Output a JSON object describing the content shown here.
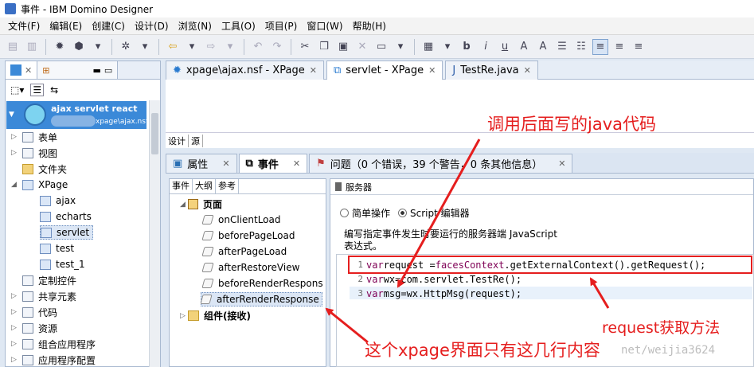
{
  "window": {
    "title": "事件 - IBM Domino Designer"
  },
  "menu": [
    "文件(F)",
    "编辑(E)",
    "创建(C)",
    "设计(D)",
    "浏览(N)",
    "工具(O)",
    "项目(P)",
    "窗口(W)",
    "帮助(H)"
  ],
  "nav": {
    "database": {
      "name": "ajax servlet react",
      "path": "xpage\\ajax.nsf"
    },
    "items": [
      {
        "label": "表单",
        "depth": 0,
        "expander": "closed",
        "icon": "form-icon"
      },
      {
        "label": "视图",
        "depth": 0,
        "expander": "closed",
        "icon": "view-icon"
      },
      {
        "label": "文件夹",
        "depth": 0,
        "expander": "none",
        "icon": "folder-icon"
      },
      {
        "label": "XPage",
        "depth": 0,
        "expander": "open",
        "icon": "xpage-icon"
      },
      {
        "label": "ajax",
        "depth": 1,
        "expander": "none",
        "icon": "xpage-icon"
      },
      {
        "label": "echarts",
        "depth": 1,
        "expander": "none",
        "icon": "xpage-icon"
      },
      {
        "label": "servlet",
        "depth": 1,
        "expander": "none",
        "icon": "xpage-icon",
        "selected": true
      },
      {
        "label": "test",
        "depth": 1,
        "expander": "none",
        "icon": "xpage-icon"
      },
      {
        "label": "test_1",
        "depth": 1,
        "expander": "none",
        "icon": "xpage-icon"
      },
      {
        "label": "定制控件",
        "depth": 0,
        "expander": "none",
        "icon": "custom-control-icon"
      },
      {
        "label": "共享元素",
        "depth": 0,
        "expander": "closed",
        "icon": "shared-elements-icon"
      },
      {
        "label": "代码",
        "depth": 0,
        "expander": "closed",
        "icon": "code-icon"
      },
      {
        "label": "资源",
        "depth": 0,
        "expander": "closed",
        "icon": "resources-icon"
      },
      {
        "label": "组合应用程序",
        "depth": 0,
        "expander": "closed",
        "icon": "composite-app-icon"
      },
      {
        "label": "应用程序配置",
        "depth": 0,
        "expander": "closed",
        "icon": "app-config-icon"
      }
    ]
  },
  "editor": {
    "tabs": [
      {
        "label": "xpage\\ajax.nsf - XPage",
        "active": false
      },
      {
        "label": "servlet - XPage",
        "active": true
      },
      {
        "label": "TestRe.java",
        "active": false
      }
    ],
    "mode_tabs": [
      "设计",
      "源"
    ]
  },
  "bottom": {
    "tabs": [
      {
        "label": "属性",
        "active": false
      },
      {
        "label": "事件",
        "active": true
      },
      {
        "label": "问题（0 个错误，39 个警告，0 条其他信息）",
        "active": false
      }
    ]
  },
  "events": {
    "subtabs": [
      "事件",
      "大纲",
      "参考"
    ],
    "group_page": "页面",
    "items": [
      "onClientLoad",
      "beforePageLoad",
      "afterPageLoad",
      "afterRestoreView",
      "beforeRenderRespons",
      "afterRenderResponse"
    ],
    "selected": "afterRenderResponse",
    "group_component": "组件(接收)"
  },
  "server": {
    "tab": "服务器",
    "radio_simple": "简单操作",
    "radio_script": "Script 编辑器",
    "desc_line1": "编写指定事件发生时要运行的服务器端 JavaScript",
    "desc_line2": "表达式。",
    "code": [
      {
        "n": "1",
        "kw": "var",
        "rest": " request = ",
        "obj": "facesContext",
        "tail": ".getExternalContext().getRequest();"
      },
      {
        "n": "2",
        "kw": "var",
        "rest": " wx=com.servlet.TestRe();",
        "obj": "",
        "tail": ""
      },
      {
        "n": "3",
        "kw": "var",
        "rest": " msg=wx.HttpMsg(request);",
        "obj": "",
        "tail": ""
      }
    ]
  },
  "annotations": {
    "top": "调用后面写的java代码",
    "right": "request获取方法",
    "bottom": "这个xpage界面只有这几行内容"
  },
  "watermark": "net/weijia3624",
  "colors": {
    "annotation": "#e51e1e",
    "selection": "#3b89d8"
  }
}
